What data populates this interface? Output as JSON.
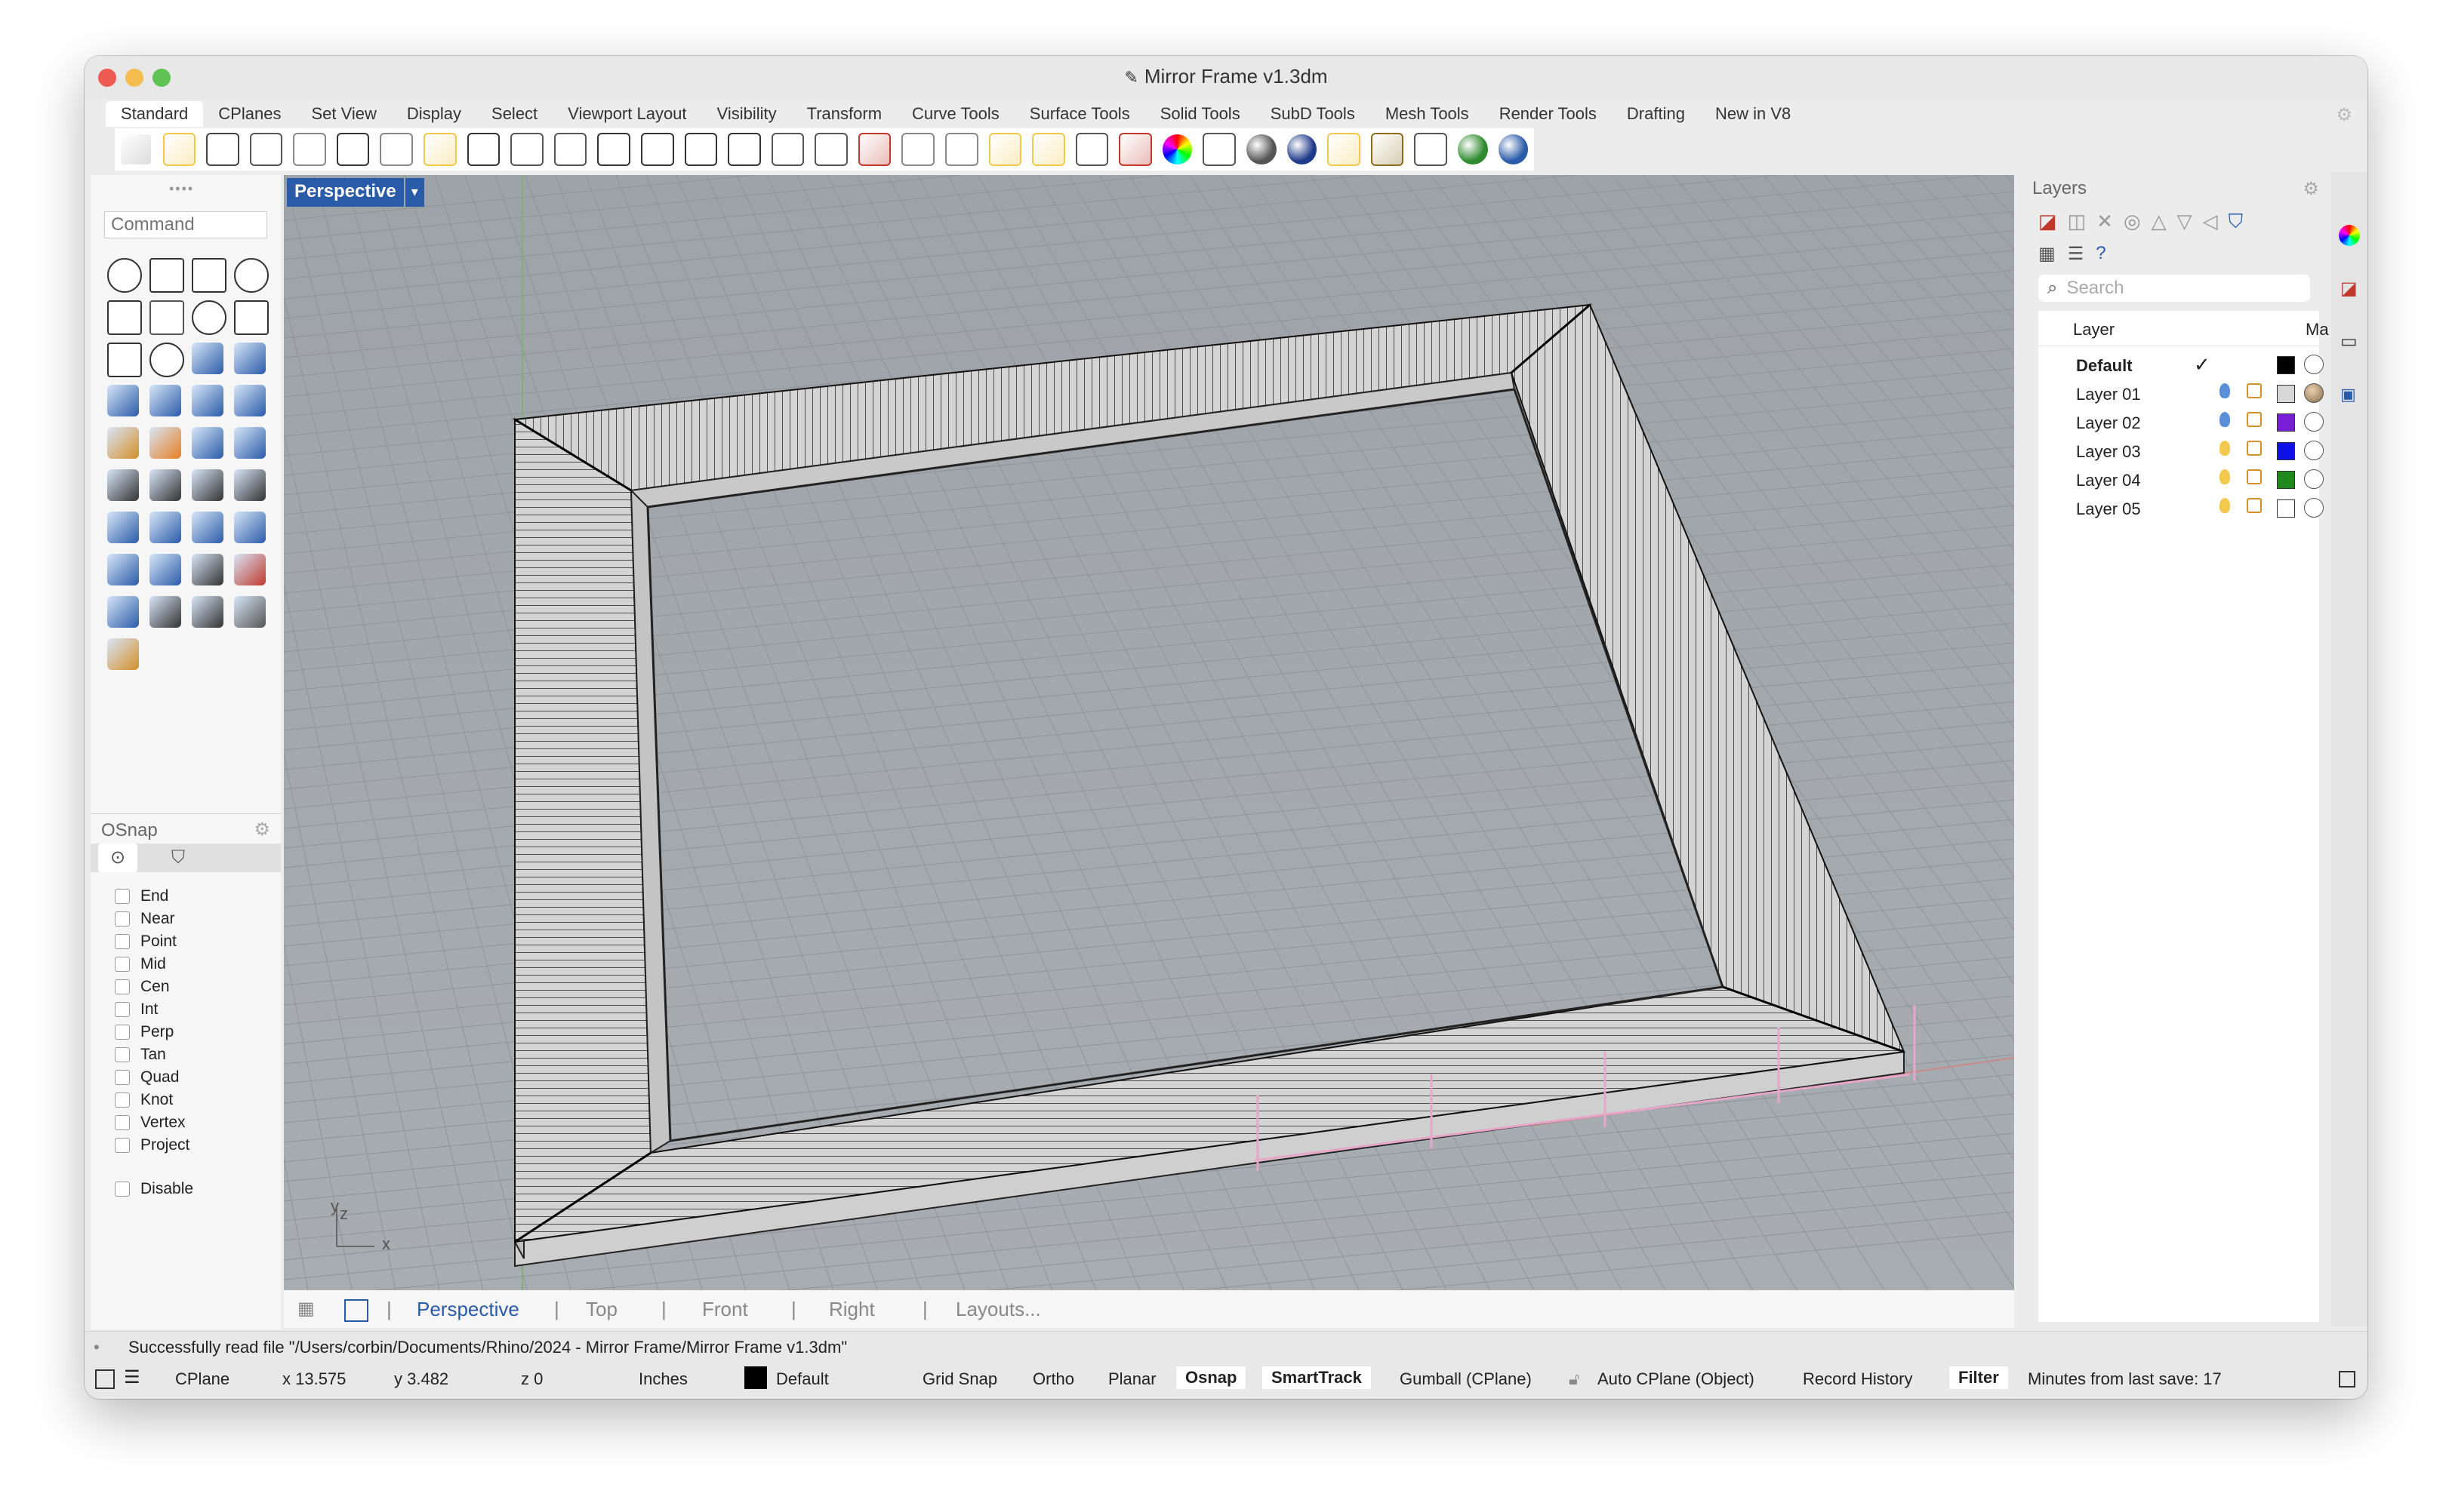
{
  "window": {
    "title": "Mirror Frame v1.3dm"
  },
  "tabs": [
    "Standard",
    "CPlanes",
    "Set View",
    "Display",
    "Select",
    "Viewport Layout",
    "Visibility",
    "Transform",
    "Curve Tools",
    "Surface Tools",
    "Solid Tools",
    "SubD Tools",
    "Mesh Tools",
    "Render Tools",
    "Drafting",
    "New in V8"
  ],
  "toolbar_icons": [
    "new-file-icon",
    "open-file-icon",
    "save-icon",
    "print-icon",
    "import-icon",
    "cut-icon",
    "copy-icon",
    "paste-icon",
    "undo-icon",
    "pan-icon",
    "rotate-view-icon",
    "zoom-icon",
    "zoom-window-icon",
    "zoom-extents-icon",
    "zoom-selected-icon",
    "undo-view-icon",
    "four-viewports-icon",
    "car-icon",
    "cplane-icon",
    "snap-icon",
    "gumball-icon",
    "light-icon",
    "lock-icon",
    "layer-icon",
    "color-wheel-icon",
    "shade-icon",
    "render-sphere-icon",
    "material-sphere-icon",
    "sun-icon",
    "gear-icon",
    "options-icon",
    "render-globe-icon",
    "help-icon"
  ],
  "command": {
    "placeholder": "Command"
  },
  "osnap": {
    "title": "OSnap",
    "items": [
      "End",
      "Near",
      "Point",
      "Mid",
      "Cen",
      "Int",
      "Perp",
      "Tan",
      "Quad",
      "Knot",
      "Vertex",
      "Project"
    ],
    "disable": "Disable"
  },
  "viewport": {
    "label": "Perspective",
    "axes": {
      "y": "y",
      "z": "z",
      "x": "x"
    },
    "tabs": [
      "Perspective",
      "Top",
      "Front",
      "Right",
      "Layouts..."
    ],
    "separator": "|"
  },
  "layers": {
    "title": "Layers",
    "search_placeholder": "Search",
    "header": {
      "layer": "Layer",
      "material": "Ma"
    },
    "rows": [
      {
        "name": "Default",
        "color": "#000000",
        "current": true,
        "check": "✓"
      },
      {
        "name": "Layer 01",
        "color": "#d8d8d8"
      },
      {
        "name": "Layer 02",
        "color": "#7a1fd8"
      },
      {
        "name": "Layer 03",
        "color": "#1010e8"
      },
      {
        "name": "Layer 04",
        "color": "#1e8a1e"
      },
      {
        "name": "Layer 05",
        "color": "#ffffff"
      }
    ]
  },
  "status": {
    "message": "Successfully read file \"/Users/corbin/Documents/Rhino/2024 - Mirror Frame/Mirror Frame v1.3dm\"",
    "cplane": "CPlane",
    "x": "x 13.575",
    "y": "y 3.482",
    "z": "z 0",
    "units": "Inches",
    "layer": "Default",
    "grid_snap": "Grid Snap",
    "ortho": "Ortho",
    "planar": "Planar",
    "osnap": "Osnap",
    "smarttrack": "SmartTrack",
    "gumball": "Gumball (CPlane)",
    "auto_cplane": "Auto CPlane (Object)",
    "record_history": "Record History",
    "filter": "Filter",
    "minutes": "Minutes from last save: 17"
  },
  "colors": {
    "accent": "#2a5ba8",
    "viewport_bg": "#a2a7ab",
    "close": "#ee5a52",
    "minimize": "#f5bd4f",
    "zoom": "#5fc454"
  }
}
